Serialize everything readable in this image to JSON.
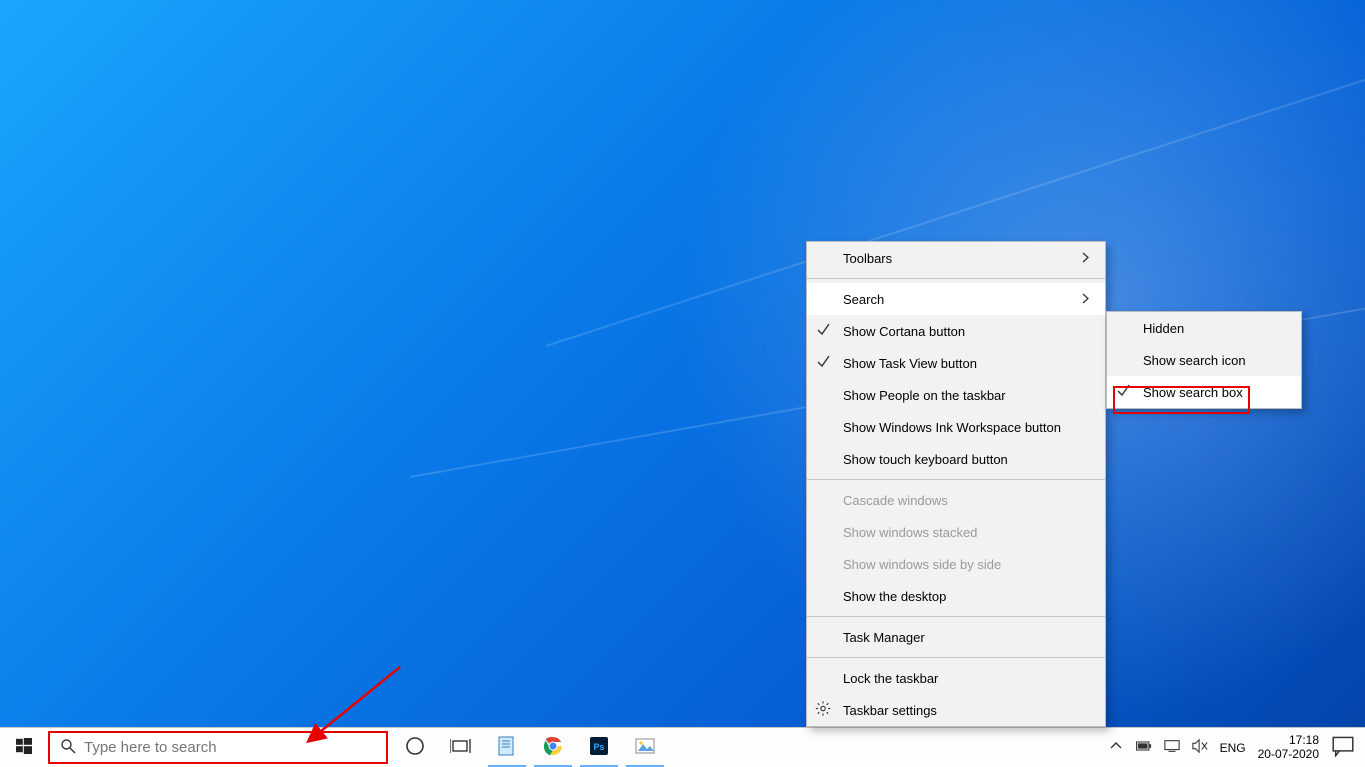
{
  "search": {
    "placeholder": "Type here to search"
  },
  "systray": {
    "language": "ENG",
    "time": "17:18",
    "date": "20-07-2020"
  },
  "context_menu": {
    "toolbars": "Toolbars",
    "search": "Search",
    "show_cortana": "Show Cortana button",
    "show_taskview": "Show Task View button",
    "show_people": "Show People on the taskbar",
    "show_ink": "Show Windows Ink Workspace button",
    "show_touchkb": "Show touch keyboard button",
    "cascade": "Cascade windows",
    "stacked": "Show windows stacked",
    "sidebyside": "Show windows side by side",
    "show_desktop": "Show the desktop",
    "task_manager": "Task Manager",
    "lock_taskbar": "Lock the taskbar",
    "taskbar_settings": "Taskbar settings"
  },
  "search_submenu": {
    "hidden": "Hidden",
    "show_icon": "Show search icon",
    "show_box": "Show search box"
  },
  "icons": {
    "start": "start-icon",
    "search": "search-icon",
    "cortana": "cortana-icon",
    "taskview": "task-view-icon",
    "notepad": "notepad-icon",
    "chrome": "chrome-icon",
    "photoshop": "photoshop-icon",
    "imageviewer": "image-viewer-icon",
    "overflow": "tray-overflow-icon",
    "battery": "battery-icon",
    "screen": "screen-icon",
    "volume": "volume-mute-icon",
    "notifications": "action-center-icon",
    "chevron": "chevron-right-icon",
    "check": "check-icon",
    "gear": "gear-icon"
  }
}
